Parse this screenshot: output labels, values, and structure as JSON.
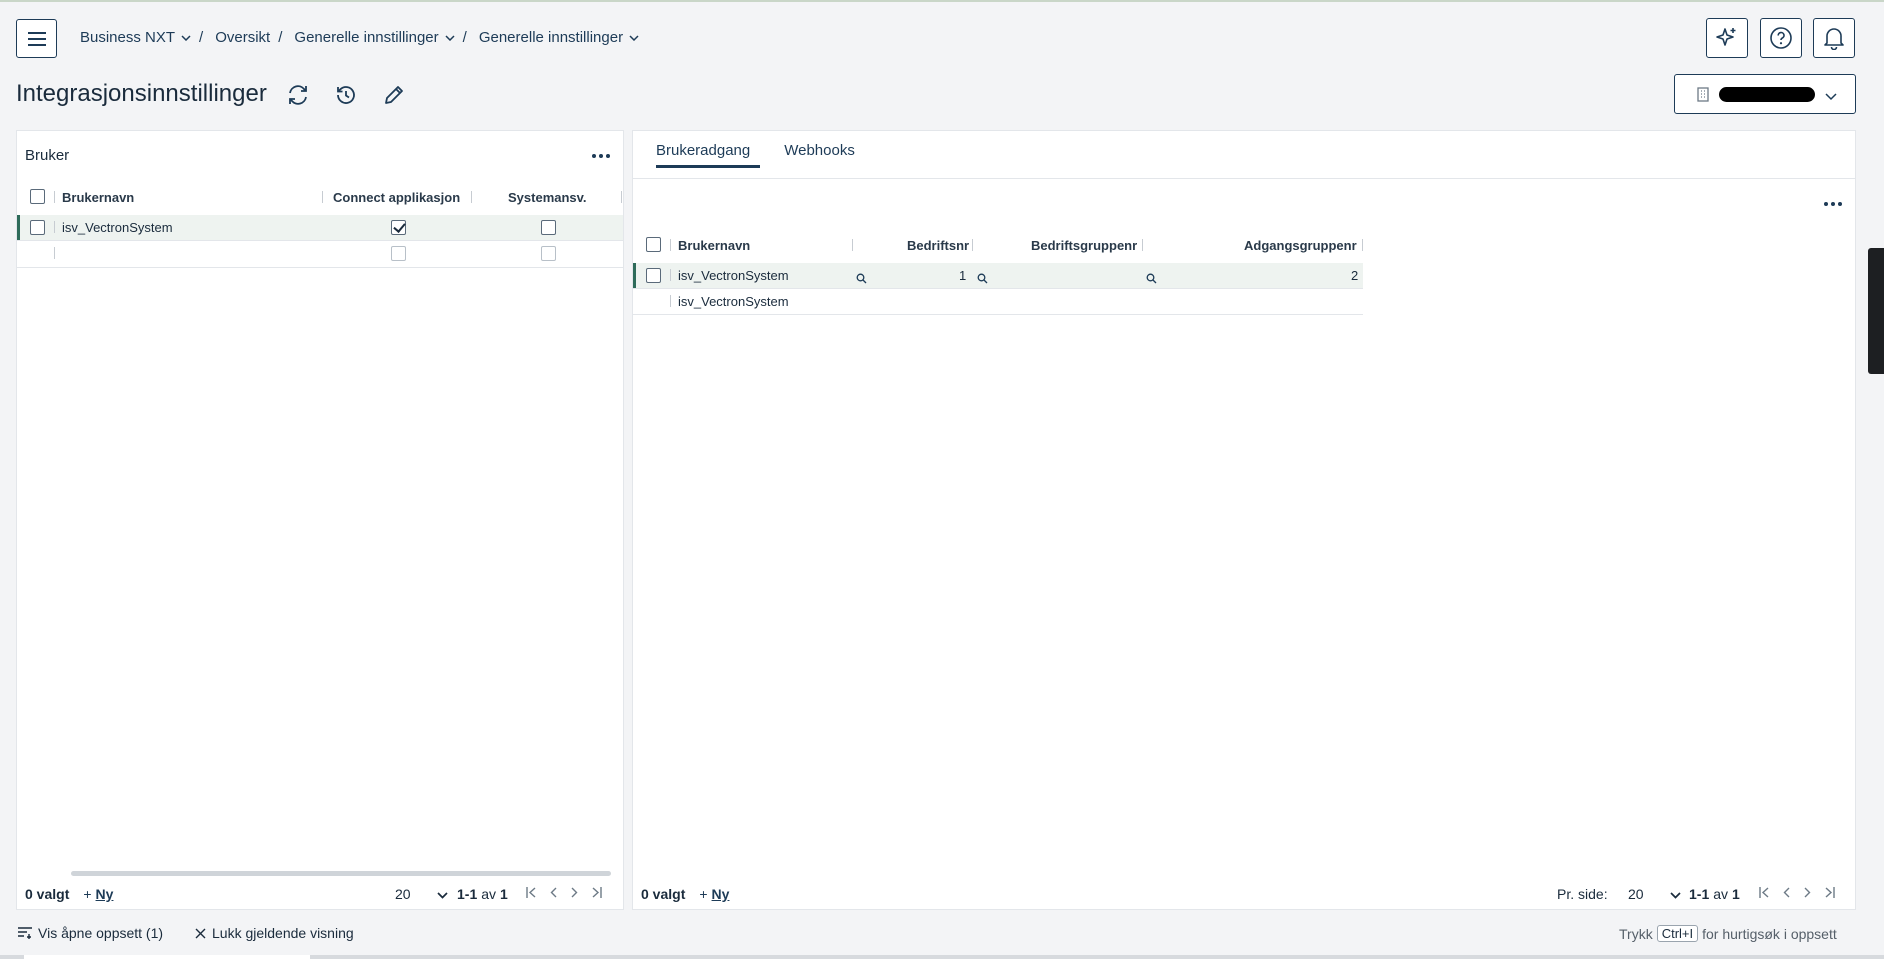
{
  "breadcrumb": [
    {
      "label": "Business NXT",
      "has_menu": true
    },
    {
      "label": "Oversikt",
      "has_menu": false
    },
    {
      "label": "Generelle innstillinger",
      "has_menu": true
    },
    {
      "label": "Generelle innstillinger",
      "has_menu": true
    }
  ],
  "header": {
    "title": "Integrasjonsinnstillinger",
    "icons": [
      "menu-icon",
      "ai-sparkle-icon",
      "help-icon",
      "bell-icon",
      "refresh-icon",
      "history-icon",
      "edit-icon",
      "building-icon"
    ]
  },
  "left": {
    "title": "Bruker",
    "columns": [
      "Brukernavn",
      "Connect applikasjon",
      "Systemansv."
    ],
    "rows": [
      {
        "username": "isv_VectronSystem",
        "connect": true,
        "sysansv": false
      },
      {
        "username": "",
        "connect": false,
        "sysansv": false
      }
    ],
    "selected": "0 valgt",
    "new_label": "Ny",
    "page_size": "20",
    "range": "1-1",
    "of": "av",
    "total": "1"
  },
  "right": {
    "tabs": [
      "Brukeradgang",
      "Webhooks"
    ],
    "columns": [
      "Brukernavn",
      "Bedriftsnr",
      "Bedriftsgruppenr",
      "Adgangsgruppenr"
    ],
    "rows": [
      {
        "username": "isv_VectronSystem",
        "bedriftsnr": "1",
        "gruppenr": "",
        "adgangsgruppenr": "2"
      },
      {
        "username": "isv_VectronSystem",
        "bedriftsnr": "",
        "gruppenr": "",
        "adgangsgruppenr": ""
      }
    ],
    "selected": "0 valgt",
    "new_label": "Ny",
    "per_page_label": "Pr. side:",
    "page_size": "20",
    "range": "1-1",
    "of": "av",
    "total": "1"
  },
  "bottom": {
    "show_open": "Vis åpne oppsett (1)",
    "close_view": "Lukk gjeldende visning",
    "hint_prefix": "Trykk",
    "hint_key": "Ctrl+I",
    "hint_suffix": "for hurtigsøk i oppsett"
  }
}
